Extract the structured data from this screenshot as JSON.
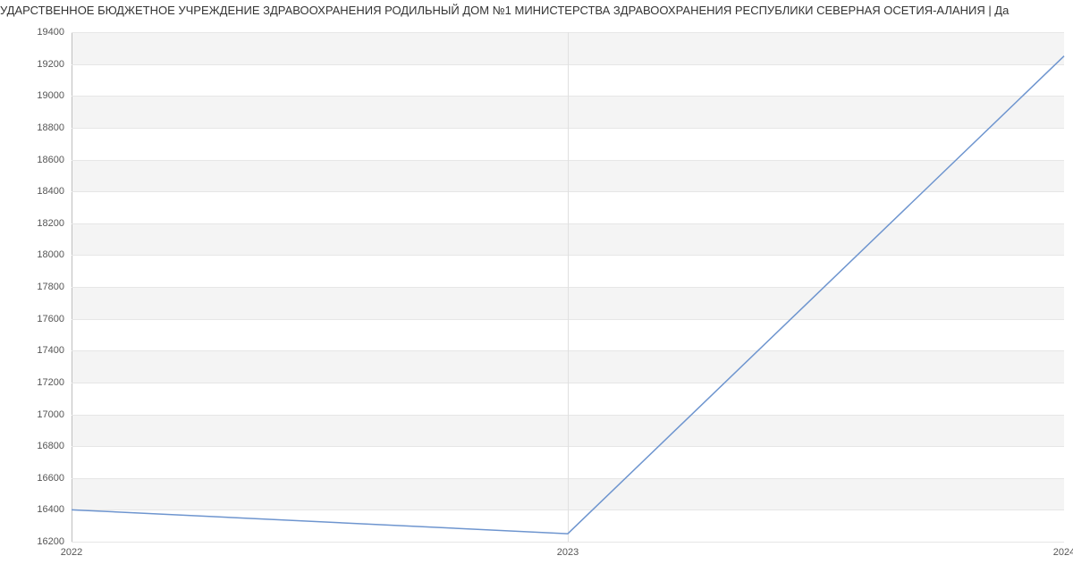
{
  "chart_data": {
    "type": "line",
    "title": "УДАРСТВЕННОЕ БЮДЖЕТНОЕ УЧРЕЖДЕНИЕ ЗДРАВООХРАНЕНИЯ РОДИЛЬНЫЙ ДОМ №1 МИНИСТЕРСТВА ЗДРАВООХРАНЕНИЯ РЕСПУБЛИКИ СЕВЕРНАЯ ОСЕТИЯ-АЛАНИЯ | Да",
    "xlabel": "",
    "ylabel": "",
    "x": [
      2022,
      2023,
      2024
    ],
    "values": [
      16400,
      16250,
      19250
    ],
    "ylim": [
      16200,
      19400
    ],
    "xlim": [
      2022,
      2024
    ],
    "y_ticks": [
      16200,
      16400,
      16600,
      16800,
      17000,
      17200,
      17400,
      17600,
      17800,
      18000,
      18200,
      18400,
      18600,
      18800,
      19000,
      19200,
      19400
    ],
    "x_ticks": [
      2022,
      2023,
      2024
    ],
    "line_color": "#6e95cf",
    "band_color": "#f4f4f4"
  }
}
